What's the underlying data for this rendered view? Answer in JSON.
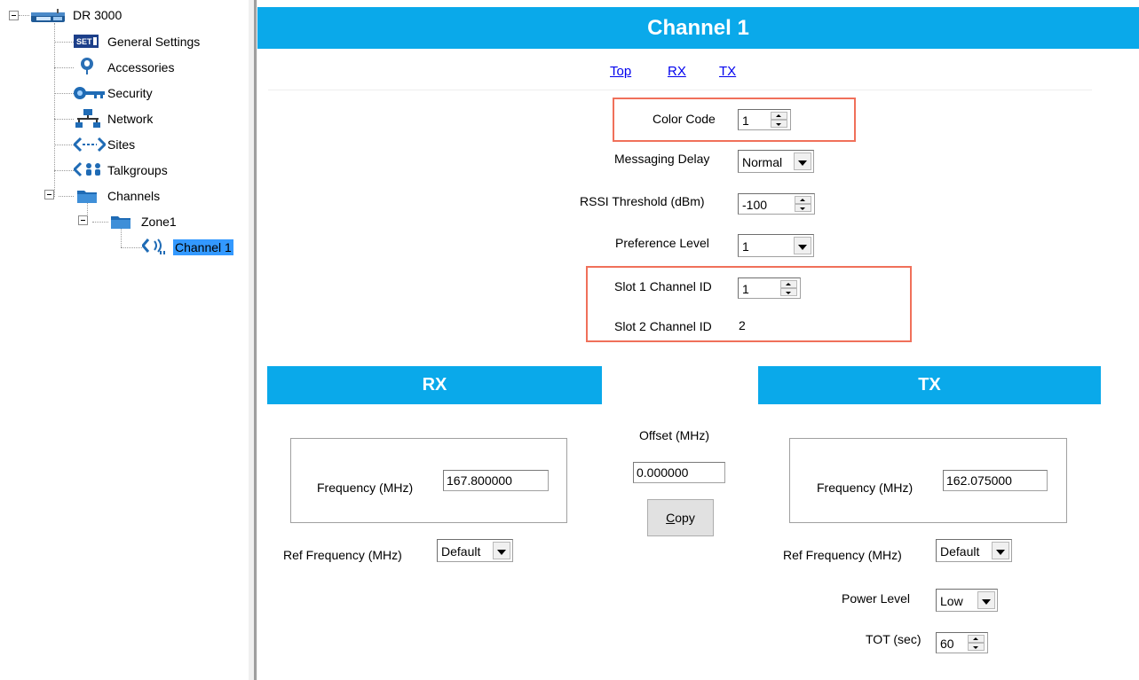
{
  "tree": {
    "root": "DR 3000",
    "items": [
      {
        "label": "General Settings",
        "icon": "settings-icon"
      },
      {
        "label": "Accessories",
        "icon": "accessories-icon"
      },
      {
        "label": "Security",
        "icon": "key-icon"
      },
      {
        "label": "Network",
        "icon": "network-icon"
      },
      {
        "label": "Sites",
        "icon": "sites-icon"
      },
      {
        "label": "Talkgroups",
        "icon": "talkgroups-icon"
      },
      {
        "label": "Channels",
        "icon": "folder-icon"
      }
    ],
    "zone": "Zone1",
    "channel": "Channel 1",
    "icon_text": {
      "settings": "SET"
    }
  },
  "page": {
    "title": "Channel 1",
    "nav": {
      "top": "Top",
      "rx": "RX",
      "tx": "TX"
    }
  },
  "fields": {
    "color_code": {
      "label": "Color Code",
      "value": "1"
    },
    "messaging_delay": {
      "label": "Messaging Delay",
      "value": "Normal"
    },
    "rssi_threshold": {
      "label": "RSSI Threshold (dBm)",
      "value": "-100"
    },
    "preference_level": {
      "label": "Preference Level",
      "value": "1"
    },
    "slot1_channel_id": {
      "label": "Slot 1 Channel ID",
      "value": "1"
    },
    "slot2_channel_id": {
      "label": "Slot 2 Channel ID",
      "value": "2"
    }
  },
  "rx": {
    "header": "RX",
    "frequency_label": "Frequency (MHz)",
    "frequency": "167.800000",
    "ref_frequency_label": "Ref Frequency (MHz)",
    "ref_frequency": "Default"
  },
  "offset": {
    "label": "Offset (MHz)",
    "value": "0.000000",
    "copy_button_first": "C",
    "copy_button_rest": "opy"
  },
  "tx": {
    "header": "TX",
    "frequency_label": "Frequency (MHz)",
    "frequency": "162.075000",
    "ref_frequency_label": "Ref Frequency (MHz)",
    "ref_frequency": "Default",
    "power_level_label": "Power Level",
    "power_level": "Low",
    "tot_label": "TOT (sec)",
    "tot": "60"
  },
  "colors": {
    "header_blue": "#0aa9ea",
    "selection": "#3399ff",
    "highlight_box": "#f0705a",
    "link": "#0000ee"
  }
}
